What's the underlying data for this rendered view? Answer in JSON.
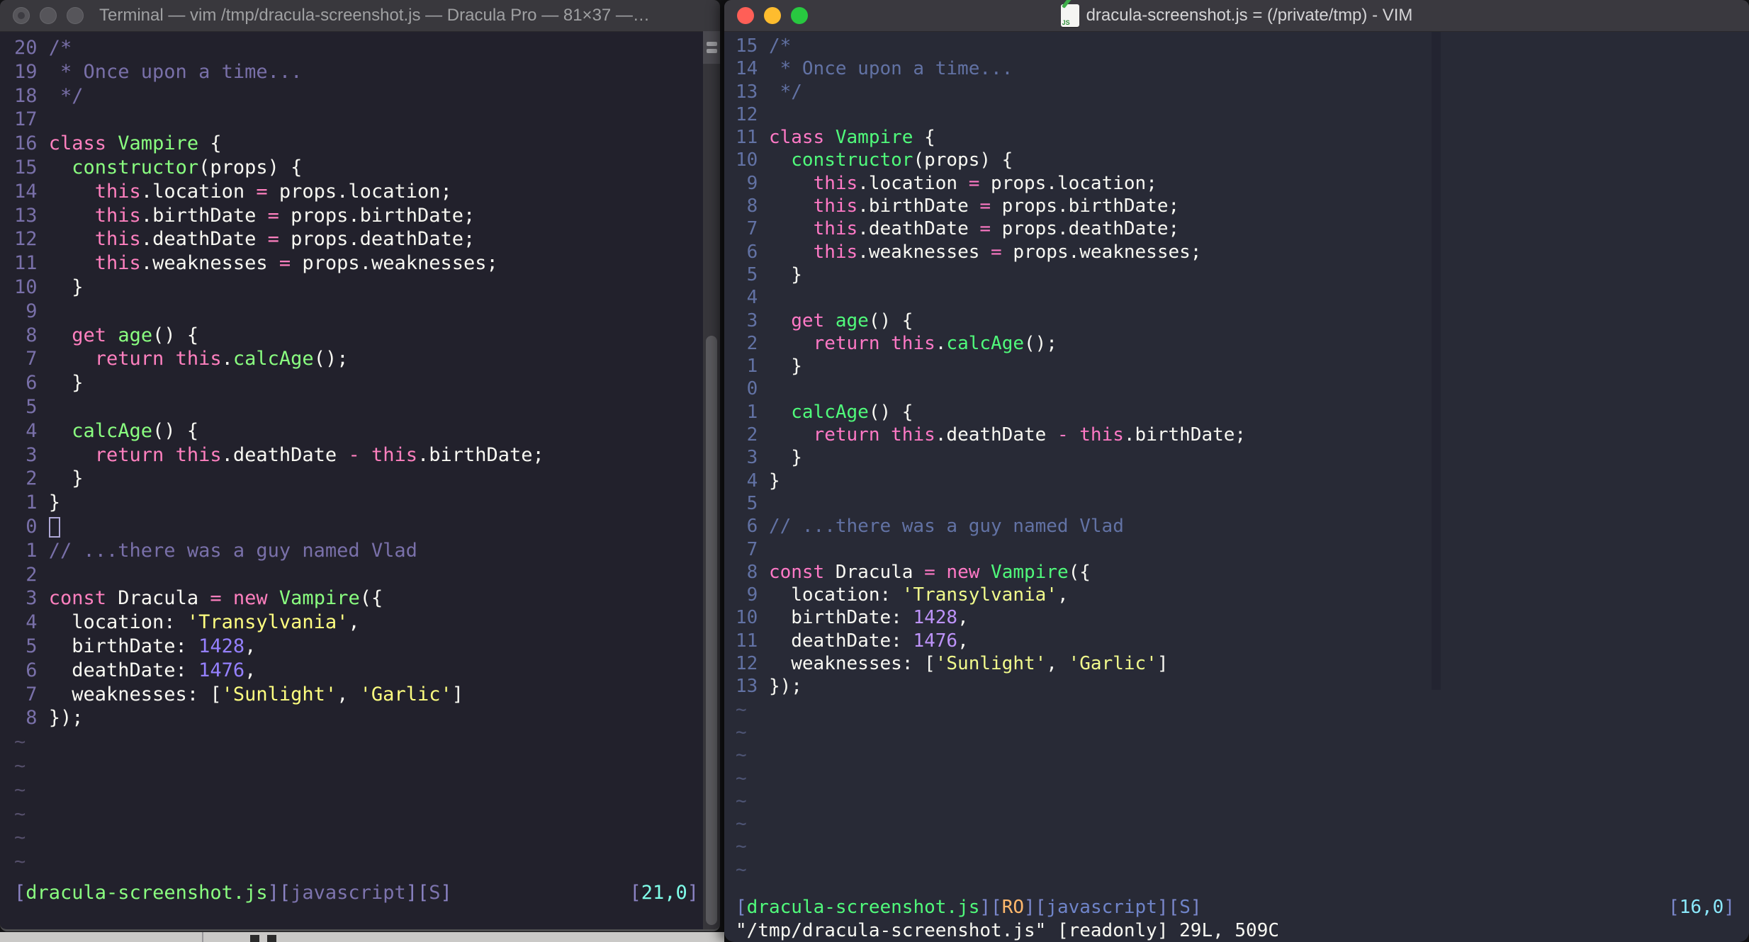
{
  "code_lines": [
    [
      [
        "c",
        "/*"
      ]
    ],
    [
      [
        "c",
        " * Once upon a time..."
      ]
    ],
    [
      [
        "c",
        " */"
      ]
    ],
    [],
    [
      [
        "k",
        "class"
      ],
      [
        "w",
        " "
      ],
      [
        "f",
        "Vampire"
      ],
      [
        "w",
        " {"
      ]
    ],
    [
      [
        "w",
        "  "
      ],
      [
        "f",
        "constructor"
      ],
      [
        "w",
        "(props) {"
      ]
    ],
    [
      [
        "w",
        "    "
      ],
      [
        "k",
        "this"
      ],
      [
        "w",
        ".location "
      ],
      [
        "k",
        "="
      ],
      [
        "w",
        " props.location;"
      ]
    ],
    [
      [
        "w",
        "    "
      ],
      [
        "k",
        "this"
      ],
      [
        "w",
        ".birthDate "
      ],
      [
        "k",
        "="
      ],
      [
        "w",
        " props.birthDate;"
      ]
    ],
    [
      [
        "w",
        "    "
      ],
      [
        "k",
        "this"
      ],
      [
        "w",
        ".deathDate "
      ],
      [
        "k",
        "="
      ],
      [
        "w",
        " props.deathDate;"
      ]
    ],
    [
      [
        "w",
        "    "
      ],
      [
        "k",
        "this"
      ],
      [
        "w",
        ".weaknesses "
      ],
      [
        "k",
        "="
      ],
      [
        "w",
        " props.weaknesses;"
      ]
    ],
    [
      [
        "w",
        "  }"
      ]
    ],
    [],
    [
      [
        "w",
        "  "
      ],
      [
        "k",
        "get"
      ],
      [
        "w",
        " "
      ],
      [
        "f",
        "age"
      ],
      [
        "w",
        "() {"
      ]
    ],
    [
      [
        "w",
        "    "
      ],
      [
        "k",
        "return"
      ],
      [
        "w",
        " "
      ],
      [
        "k",
        "this"
      ],
      [
        "w",
        "."
      ],
      [
        "f",
        "calcAge"
      ],
      [
        "w",
        "();"
      ]
    ],
    [
      [
        "w",
        "  }"
      ]
    ],
    [],
    [
      [
        "w",
        "  "
      ],
      [
        "f",
        "calcAge"
      ],
      [
        "w",
        "() {"
      ]
    ],
    [
      [
        "w",
        "    "
      ],
      [
        "k",
        "return"
      ],
      [
        "w",
        " "
      ],
      [
        "k",
        "this"
      ],
      [
        "w",
        ".deathDate "
      ],
      [
        "k",
        "-"
      ],
      [
        "w",
        " "
      ],
      [
        "k",
        "this"
      ],
      [
        "w",
        ".birthDate;"
      ]
    ],
    [
      [
        "w",
        "  }"
      ]
    ],
    [
      [
        "w",
        "}"
      ]
    ],
    [],
    [
      [
        "c",
        "// ...there was a guy named Vlad"
      ]
    ],
    [],
    [
      [
        "k",
        "const"
      ],
      [
        "w",
        " Dracula "
      ],
      [
        "k",
        "="
      ],
      [
        "w",
        " "
      ],
      [
        "k",
        "new"
      ],
      [
        "w",
        " "
      ],
      [
        "f",
        "Vampire"
      ],
      [
        "w",
        "({"
      ]
    ],
    [
      [
        "w",
        "  location: "
      ],
      [
        "s",
        "'Transylvania'"
      ],
      [
        "w",
        ","
      ]
    ],
    [
      [
        "w",
        "  birthDate: "
      ],
      [
        "n",
        "1428"
      ],
      [
        "w",
        ","
      ]
    ],
    [
      [
        "w",
        "  deathDate: "
      ],
      [
        "n",
        "1476"
      ],
      [
        "w",
        ","
      ]
    ],
    [
      [
        "w",
        "  weaknesses: ["
      ],
      [
        "s",
        "'Sunlight'"
      ],
      [
        "w",
        ", "
      ],
      [
        "s",
        "'Garlic'"
      ],
      [
        "w",
        "]"
      ]
    ],
    [
      [
        "w",
        "});"
      ]
    ]
  ],
  "left_window": {
    "title": "Terminal — vim /tmp/dracula-screenshot.js — Dracula Pro — 81×37 —…",
    "theme_name": "Dracula Pro",
    "palette": {
      "bg": "#22212C",
      "w": "#F8F8F2",
      "c": "#7970A9",
      "k": "#FF80BF",
      "f": "#8AFF80",
      "s": "#FFFF80",
      "n": "#9580FF",
      "ln": "#7970A9",
      "tilde": "#554F6B",
      "br": "#8B83C4",
      "file": "#8AFF80",
      "lang": "#7D74AE",
      "pos": "#80FFEA",
      "ro": "#FFCA80"
    },
    "numbers": [
      "20",
      "19",
      "18",
      "17",
      "16",
      "15",
      "14",
      "13",
      "12",
      "11",
      "10",
      "9",
      "8",
      "7",
      "6",
      "5",
      "4",
      "3",
      "2",
      "1",
      "0",
      "1",
      "2",
      "3",
      "4",
      "5",
      "6",
      "7",
      "8"
    ],
    "cursor_row": 20,
    "tilde_count": 6,
    "tilde_char": "~",
    "status_left": [
      [
        "br",
        "["
      ],
      [
        "file",
        "dracula-screenshot.js"
      ],
      [
        "br",
        "]["
      ],
      [
        "lang",
        "javascript"
      ],
      [
        "br",
        "]["
      ],
      [
        "lang",
        "S"
      ],
      [
        "br",
        "]"
      ]
    ],
    "status_right": [
      [
        "br",
        "["
      ],
      [
        "pos",
        "21,0"
      ],
      [
        "br",
        "]"
      ]
    ],
    "cmd_line": ""
  },
  "right_window": {
    "title": "dracula-screenshot.js = (/private/tmp) - VIM",
    "doc_icon_label": "JS",
    "palette": {
      "bg": "#282A36",
      "w": "#F8F8F2",
      "c": "#6272A4",
      "k": "#FF79C6",
      "f": "#50FA7B",
      "s": "#F1FA8C",
      "n": "#BD93F9",
      "ln": "#6272A4",
      "tilde": "#4E5575",
      "br": "#7B88CC",
      "file": "#50FA7B",
      "lang": "#6F84C9",
      "pos": "#8BE9FD",
      "ro": "#FFB86C"
    },
    "numbers": [
      "15",
      "14",
      "13",
      "12",
      "11",
      "10",
      "9",
      "8",
      "7",
      "6",
      "5",
      "4",
      "3",
      "2",
      "1",
      "0",
      "1",
      "2",
      "3",
      "4",
      "5",
      "6",
      "7",
      "8",
      "9",
      "10",
      "11",
      "12",
      "13"
    ],
    "cursor_row": -1,
    "tilde_count": 8,
    "tilde_char": "~",
    "status_left": [
      [
        "br",
        "["
      ],
      [
        "file",
        "dracula-screenshot.js"
      ],
      [
        "br",
        "]["
      ],
      [
        "ro",
        "RO"
      ],
      [
        "br",
        "]["
      ],
      [
        "lang",
        "javascript"
      ],
      [
        "br",
        "]["
      ],
      [
        "lang",
        "S"
      ],
      [
        "br",
        "]"
      ]
    ],
    "status_right": [
      [
        "br",
        "["
      ],
      [
        "pos",
        "16,0"
      ],
      [
        "br",
        "]"
      ]
    ],
    "cmd_line": "\"/tmp/dracula-screenshot.js\" [readonly] 29L, 509C"
  }
}
